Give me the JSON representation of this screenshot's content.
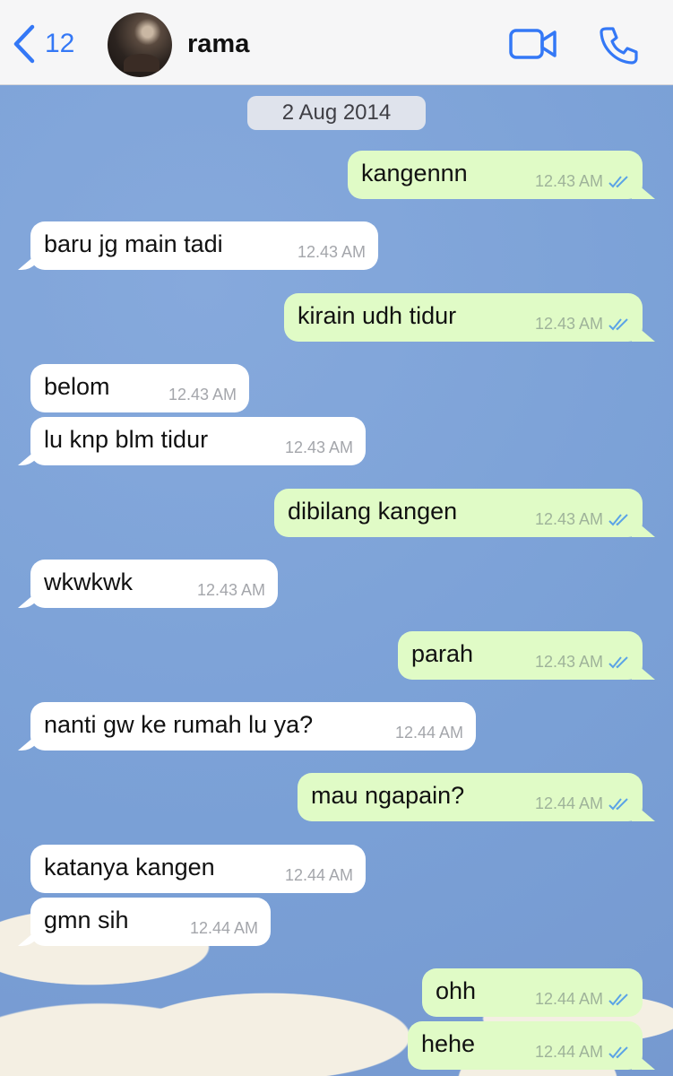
{
  "header": {
    "back_count": "12",
    "contact_name": "rama",
    "icons": {
      "back": "chevron-left-icon",
      "video": "video-camera-icon",
      "call": "phone-icon"
    },
    "accent_color": "#3478f6"
  },
  "chat": {
    "date_label": "2 Aug 2014",
    "messages": [
      {
        "direction": "out",
        "text": "kangennn",
        "time": "12.43 AM",
        "status": "read"
      },
      {
        "direction": "in",
        "text": "baru jg main tadi",
        "time": "12.43 AM"
      },
      {
        "direction": "out",
        "text": "kirain udh tidur",
        "time": "12.43 AM",
        "status": "read"
      },
      {
        "direction": "in",
        "text": "belom",
        "time": "12.43 AM"
      },
      {
        "direction": "in",
        "text": "lu knp blm tidur",
        "time": "12.43 AM"
      },
      {
        "direction": "out",
        "text": "dibilang kangen",
        "time": "12.43 AM",
        "status": "read"
      },
      {
        "direction": "in",
        "text": "wkwkwk",
        "time": "12.43 AM"
      },
      {
        "direction": "out",
        "text": "parah",
        "time": "12.43 AM",
        "status": "read"
      },
      {
        "direction": "in",
        "text": "nanti gw ke rumah lu ya?",
        "time": "12.44 AM"
      },
      {
        "direction": "out",
        "text": "mau ngapain?",
        "time": "12.44 AM",
        "status": "read"
      },
      {
        "direction": "in",
        "text": "katanya kangen",
        "time": "12.44 AM"
      },
      {
        "direction": "in",
        "text": "gmn sih",
        "time": "12.44 AM"
      },
      {
        "direction": "out",
        "text": "ohh",
        "time": "12.44 AM",
        "status": "read"
      },
      {
        "direction": "out",
        "text": "hehe",
        "time": "12.44 AM",
        "status": "read"
      }
    ]
  },
  "colors": {
    "incoming_bubble": "#ffffff",
    "outgoing_bubble": "#e0fbc6",
    "read_ticks": "#5ba3e6",
    "wallpaper": "#7fa3d8"
  }
}
